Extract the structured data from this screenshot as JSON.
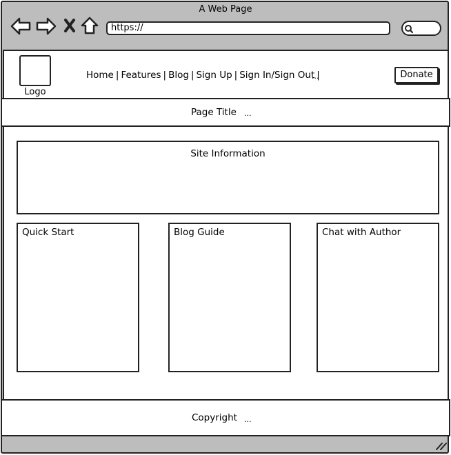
{
  "window": {
    "title": "A Web Page"
  },
  "browser": {
    "url": "https://",
    "icons": [
      "back-arrow-icon",
      "forward-arrow-icon",
      "close-icon",
      "home-icon",
      "search-icon"
    ]
  },
  "header": {
    "logo_label": "Logo",
    "nav": [
      "Home",
      "Features",
      "Blog",
      "Sign Up",
      "Sign In/Sign Out"
    ],
    "nav_ellipsis": "...",
    "donate_label": "Donate"
  },
  "title_bar": {
    "title": "Page Title",
    "ellipsis": "..."
  },
  "main": {
    "site_info": "Site Information",
    "panels": [
      "Quick Start",
      "Blog Guide",
      "Chat with Author"
    ]
  },
  "footer": {
    "copyright": "Copyright",
    "ellipsis": "..."
  }
}
